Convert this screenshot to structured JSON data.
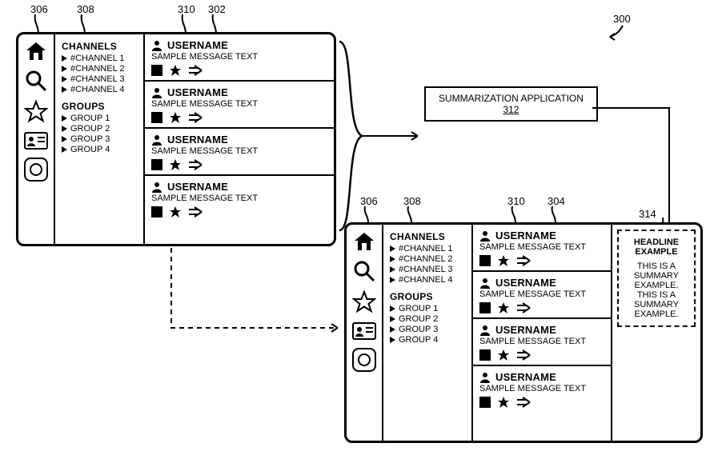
{
  "figure_ref": "300",
  "refs": {
    "r306a": "306",
    "r308a": "308",
    "r310a": "310",
    "r302": "302",
    "r306b": "306",
    "r308b": "308",
    "r310b": "310",
    "r304": "304",
    "r314": "314",
    "r312": "312"
  },
  "app_box": {
    "title": "SUMMARIZATION APPLICATION",
    "ref": "312"
  },
  "channels_header": "CHANNELS",
  "groups_header": "GROUPS",
  "channels": [
    "#CHANNEL 1",
    "#CHANNEL 2",
    "#CHANNEL 3",
    "#CHANNEL 4"
  ],
  "groups": [
    "GROUP 1",
    "GROUP 2",
    "GROUP 3",
    "GROUP 4"
  ],
  "messages": [
    {
      "user": "USERNAME",
      "text": "SAMPLE MESSAGE TEXT"
    },
    {
      "user": "USERNAME",
      "text": "SAMPLE MESSAGE TEXT"
    },
    {
      "user": "USERNAME",
      "text": "SAMPLE MESSAGE TEXT"
    },
    {
      "user": "USERNAME",
      "text": "SAMPLE MESSAGE TEXT"
    }
  ],
  "summary": {
    "headline": "HEADLINE EXAMPLE",
    "body": "THIS IS A SUMMARY EXAMPLE. THIS IS A SUMMARY EXAMPLE."
  },
  "sidebar_icons": [
    "home",
    "search",
    "star",
    "id-card",
    "circle"
  ]
}
